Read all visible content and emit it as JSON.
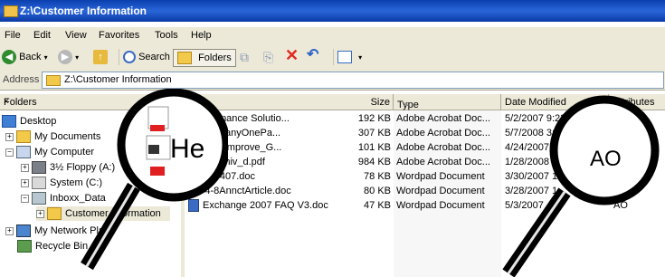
{
  "window": {
    "title": "Z:\\Customer Information"
  },
  "menu": [
    "File",
    "Edit",
    "View",
    "Favorites",
    "Tools",
    "Help"
  ],
  "toolbar": {
    "back": "Back",
    "search": "Search",
    "folders": "Folders"
  },
  "address": {
    "label": "Address",
    "value": "Z:\\Customer Information"
  },
  "folders_pane": {
    "title": "Folders",
    "close": "×",
    "items": [
      {
        "label": "Desktop",
        "icon": "desktop-icon"
      },
      {
        "label": "My Documents",
        "icon": "folder-icon"
      },
      {
        "label": "My Computer",
        "icon": "computer-icon"
      },
      {
        "label": "3½ Floppy (A:)",
        "icon": "floppy-icon"
      },
      {
        "label": "System (C:)",
        "icon": "drive-icon"
      },
      {
        "label": "Inboxx_Data",
        "icon": "network-drive-icon"
      },
      {
        "label": "Customer Information",
        "icon": "folder-open-icon"
      },
      {
        "label": "My Network Pla",
        "icon": "network-icon"
      },
      {
        "label": "Recycle Bin",
        "icon": "recycle-bin-icon"
      }
    ]
  },
  "columns": {
    "name": "",
    "size": "Size",
    "type": "Type",
    "modified": "Date Modified",
    "attributes": "Attributes"
  },
  "files": [
    {
      "name": "f Governance Solutio...",
      "size": "192 KB",
      "type": "Adobe Acrobat Doc...",
      "modified": "5/2/2007 9:23",
      "attr": ""
    },
    {
      "name": "x_CompanyOnePa...",
      "size": "307 KB",
      "type": "Adobe Acrobat Doc...",
      "modified": "5/7/2008 3:4",
      "attr": ""
    },
    {
      "name": "tomers_Improve_G...",
      "size": "101 KB",
      "type": "Adobe Acrobat Doc...",
      "modified": "4/24/2007 1",
      "attr": ""
    },
    {
      "name": "Mail-Archiv_d.pdf",
      "size": "984 KB",
      "type": "Adobe Acrobat Doc...",
      "modified": "1/28/2008 1",
      "attr": ""
    },
    {
      "name": "Glance407.doc",
      "size": "78 KB",
      "type": "Wordpad Document",
      "modified": "3/30/2007 1",
      "attr": ""
    },
    {
      "name": "ailV4-8AnnctArticle.doc",
      "size": "80 KB",
      "type": "Wordpad Document",
      "modified": "3/28/2007 1",
      "attr": ""
    },
    {
      "name": "Exchange 2007 FAQ V3.doc",
      "size": "47 KB",
      "type": "Wordpad Document",
      "modified": "5/3/2007",
      "attr": "AO"
    }
  ],
  "zoom_left": {
    "text": "He"
  },
  "zoom_right": {
    "text": "AO"
  }
}
